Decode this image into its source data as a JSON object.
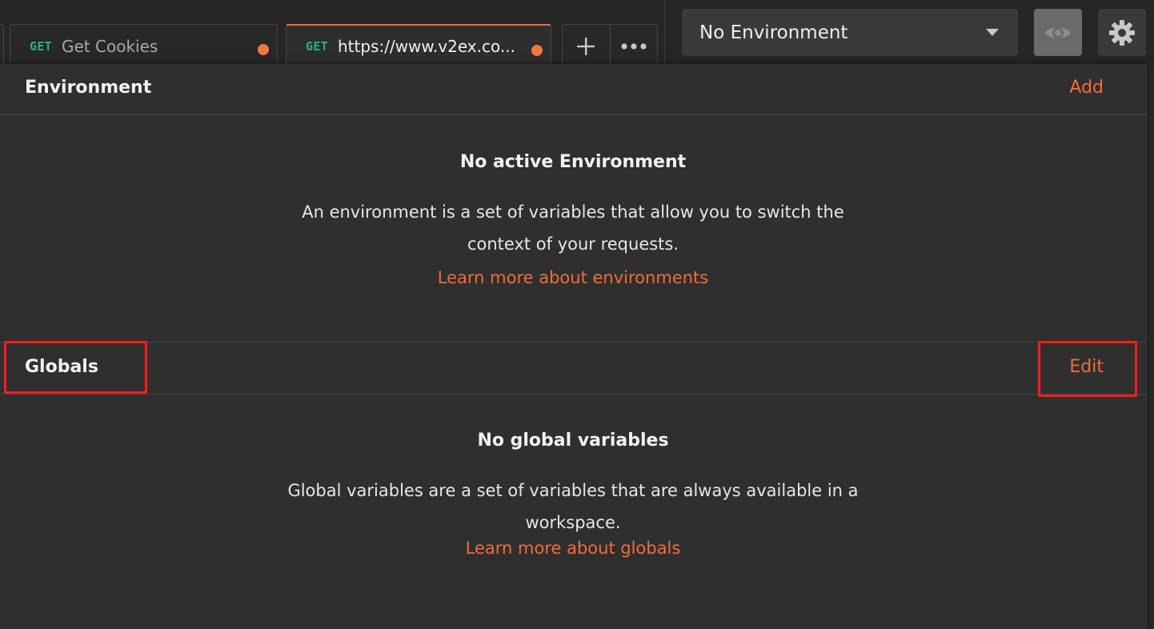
{
  "tabs": [
    {
      "method": "GET",
      "title": "Get Cookies",
      "unsaved": true
    },
    {
      "method": "GET",
      "title": "https://www.v2ex.co...",
      "unsaved": true,
      "active": true
    }
  ],
  "tab_actions": {
    "new_tab_icon": "plus-icon",
    "more_icon": "more-horizontal-icon"
  },
  "environment_selector": {
    "value": "No Environment"
  },
  "top_icons": {
    "quick_look": "eye-icon",
    "settings": "gear-icon"
  },
  "environment": {
    "title": "Environment",
    "action": "Add",
    "empty_title": "No active Environment",
    "empty_desc": "An environment is a set of variables that allow you to switch the context of your requests.",
    "learn_more": "Learn more about environments"
  },
  "globals": {
    "title": "Globals",
    "action": "Edit",
    "empty_title": "No global variables",
    "empty_desc": "Global variables are a set of variables that are always available in a workspace.",
    "learn_more": "Learn more about globals"
  },
  "colors": {
    "accent": "#f26b3a",
    "get_method": "#2bb27d",
    "annotation": "#ff1a1a"
  }
}
